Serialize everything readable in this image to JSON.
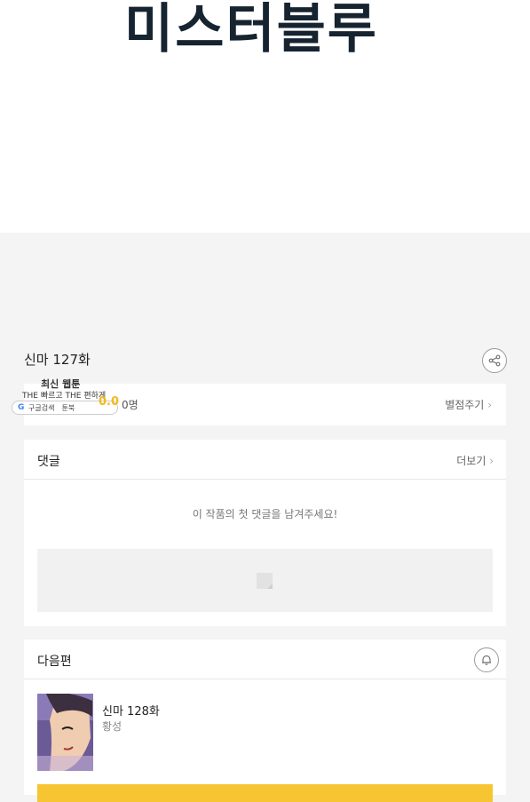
{
  "banner": {
    "logo_text": "미스터블루"
  },
  "episode": {
    "title": "신마 127화"
  },
  "ad": {
    "title": "최신 웹툰",
    "subtitle": "THE 빠르고 THE 편하게",
    "pill_left": "구글검색",
    "pill_right": "툰북",
    "score": "0.0"
  },
  "rating": {
    "count": "0명",
    "link": "별점주기"
  },
  "comments": {
    "label": "댓글",
    "more": "더보기",
    "empty_message": "이 작품의 첫 댓글을 남겨주세요!"
  },
  "next": {
    "label": "다음편",
    "episode_title": "신마 128화",
    "author": "황성"
  },
  "colors": {
    "accent": "#f7c531",
    "score": "#f5b81c",
    "banner_text": "#162330"
  }
}
